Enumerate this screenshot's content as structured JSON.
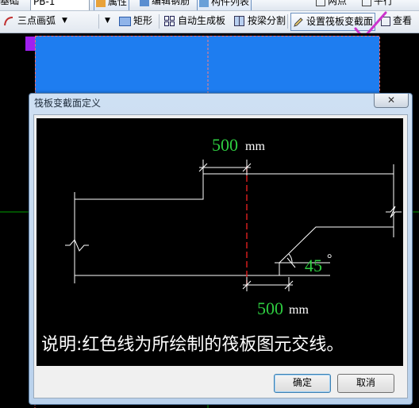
{
  "toolbar_top": {
    "left_fragment": "基础",
    "combo_value": "PB-1",
    "attribute_label": "属性",
    "edit_rebar_label": "编辑钢筋",
    "component_list_label": "构件列表",
    "grid_label": "两点",
    "parallel_label": "平行"
  },
  "toolbar": {
    "arc_label": "三点画弧",
    "rect_label": "矩形",
    "auto_gen_label": "自动生成板",
    "split_by_beam_label": "按梁分割",
    "set_section_label": "设置筏板变截面",
    "view_label": "查看"
  },
  "dialog": {
    "title": "筏板变截面定义",
    "close_label": "✕",
    "ok_label": "确定",
    "cancel_label": "取消",
    "diagram": {
      "top_dim_value": "500",
      "top_dim_unit": "mm",
      "bottom_dim_value": "500",
      "bottom_dim_unit": "mm",
      "angle_value": "45",
      "angle_unit": "°",
      "note": "说明:红色线为所绘制的筏板图元交线。"
    }
  },
  "colors": {
    "dim_text": "#2ecc40",
    "intersection_line": "#e02020",
    "outline": "#ffffff",
    "canvas_bg": "#000000",
    "slab_fill": "#1e7df0",
    "check_mark": "#cc33cc"
  }
}
